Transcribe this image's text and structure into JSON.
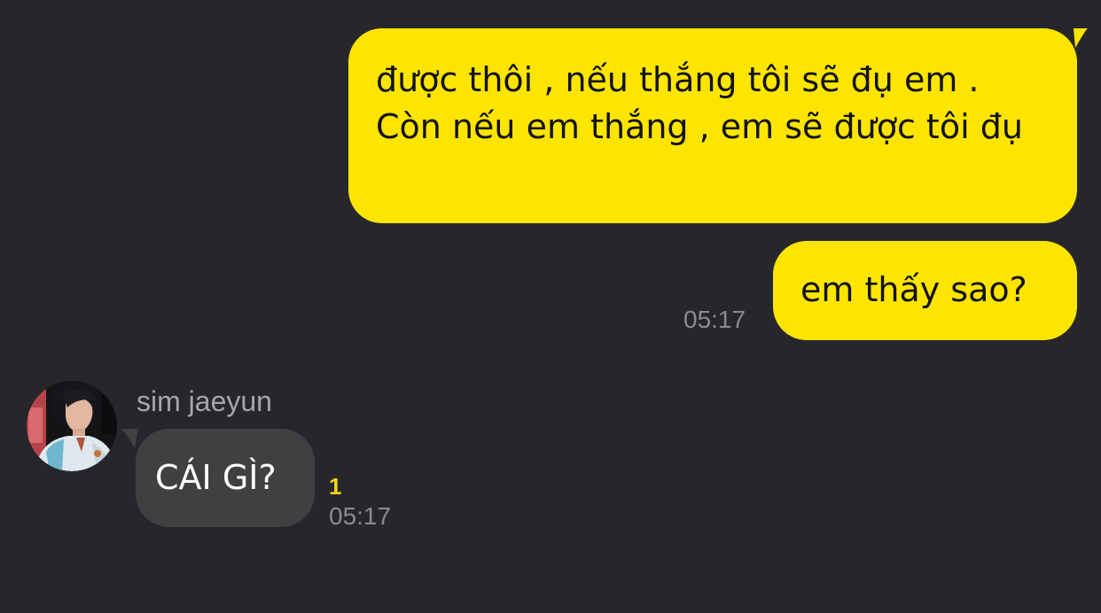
{
  "conversation": {
    "messages": [
      {
        "direction": "outgoing",
        "text": "được thôi , nếu thắng tôi sẽ đụ em . Còn nếu em thắng , em sẽ được tôi đụ",
        "timestamp": ""
      },
      {
        "direction": "outgoing",
        "text": "em thấy sao?",
        "timestamp": "05:17"
      },
      {
        "direction": "incoming",
        "sender": "sim jaeyun",
        "text": "CÁI GÌ?",
        "unread_count": "1",
        "timestamp": "05:17"
      }
    ]
  },
  "colors": {
    "background": "#27272b",
    "outgoing_bubble": "#fee500",
    "incoming_bubble": "#404043",
    "timestamp": "#8b8b8f",
    "sender_name": "#a5a5aa",
    "unread_count": "#f5d611"
  },
  "icons": {
    "avatar": "sender-profile-photo"
  }
}
